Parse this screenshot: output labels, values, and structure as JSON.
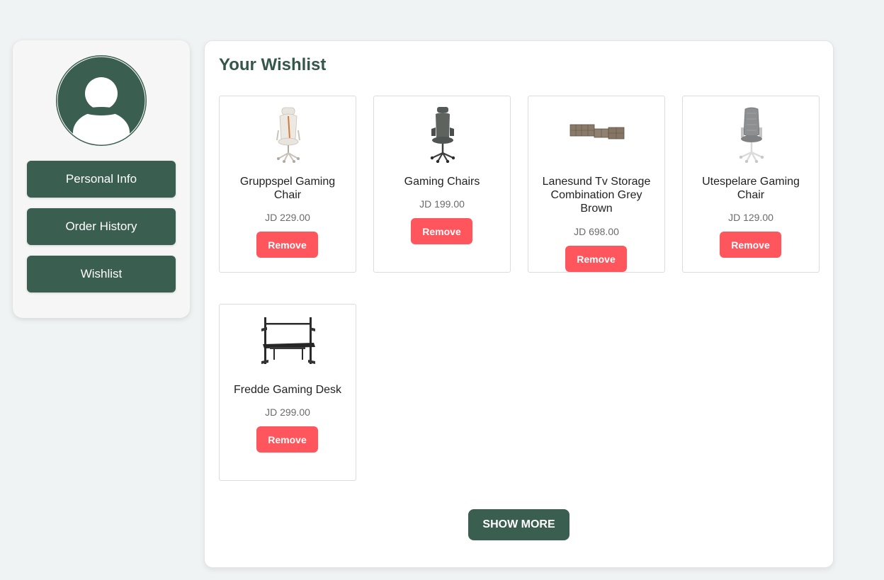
{
  "sidebar": {
    "avatar_icon": "user-avatar-icon",
    "items": [
      {
        "label": "Personal Info"
      },
      {
        "label": "Order History"
      },
      {
        "label": "Wishlist"
      }
    ]
  },
  "wishlist": {
    "title": "Your Wishlist",
    "items": [
      {
        "name": "Gruppspel Gaming Chair",
        "price": "JD 229.00",
        "remove_label": "Remove",
        "image_icon": "white-gaming-chair"
      },
      {
        "name": "Gaming Chairs",
        "price": "JD 199.00",
        "remove_label": "Remove",
        "image_icon": "dark-gaming-chair"
      },
      {
        "name": "Lanesund Tv Storage Combination Grey Brown",
        "price": "JD 698.00",
        "remove_label": "Remove",
        "image_icon": "tv-storage-unit"
      },
      {
        "name": "Utespelare Gaming Chair",
        "price": "JD 129.00",
        "remove_label": "Remove",
        "image_icon": "grey-gaming-chair"
      },
      {
        "name": "Fredde Gaming Desk",
        "price": "JD 299.00",
        "remove_label": "Remove",
        "image_icon": "gaming-desk"
      }
    ],
    "show_more_label": "SHOW MORE"
  },
  "colors": {
    "primary": "#3a5e4f",
    "remove": "#ff555c",
    "background": "#f0f3f4",
    "title": "#34574a"
  }
}
